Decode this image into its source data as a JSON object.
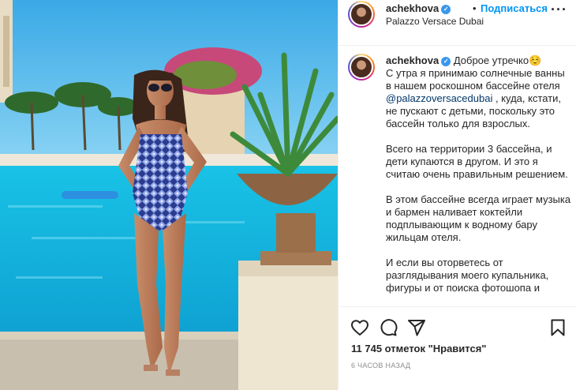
{
  "post": {
    "username": "achekhova",
    "verified_mark": "✓",
    "separator": "•",
    "follow_label": "Подписаться",
    "location": "Palazzo Versace Dubai",
    "more_label": "···"
  },
  "caption": {
    "username": "achekhova",
    "greeting": "Доброе утречко☺️",
    "p1_before": "С утра я принимаю солнечные ванны в нашем роскошном бассейне отеля ",
    "p1_mention": "@palazzoversacedubai",
    "p1_after": " , куда, кстати, не пускают с детьми, поскольку это бассейн только для взрослых.",
    "p2": "Всего на территории 3 бассейна, и дети купаются в другом. И это я считаю очень правильным решением.",
    "p3": "В этом бассейне всегда играет музыка и бармен наливает коктейли подплывающим к водному бару жильцам отеля.",
    "p4": "И если вы оторветесь от разглядывания моего купальника, фигуры и от поиска фотошопа и"
  },
  "actions": {
    "like_icon": "heart-icon",
    "comment_icon": "comment-icon",
    "share_icon": "share-icon",
    "save_icon": "bookmark-icon",
    "likes_text": "11 745 отметок \"Нравится\"",
    "timestamp": "6 ЧАСОВ НАЗАД"
  },
  "colors": {
    "follow_blue": "#0095f6",
    "verified_blue": "#3897f0",
    "mention": "#00376b",
    "muted": "#8e8e8e"
  }
}
